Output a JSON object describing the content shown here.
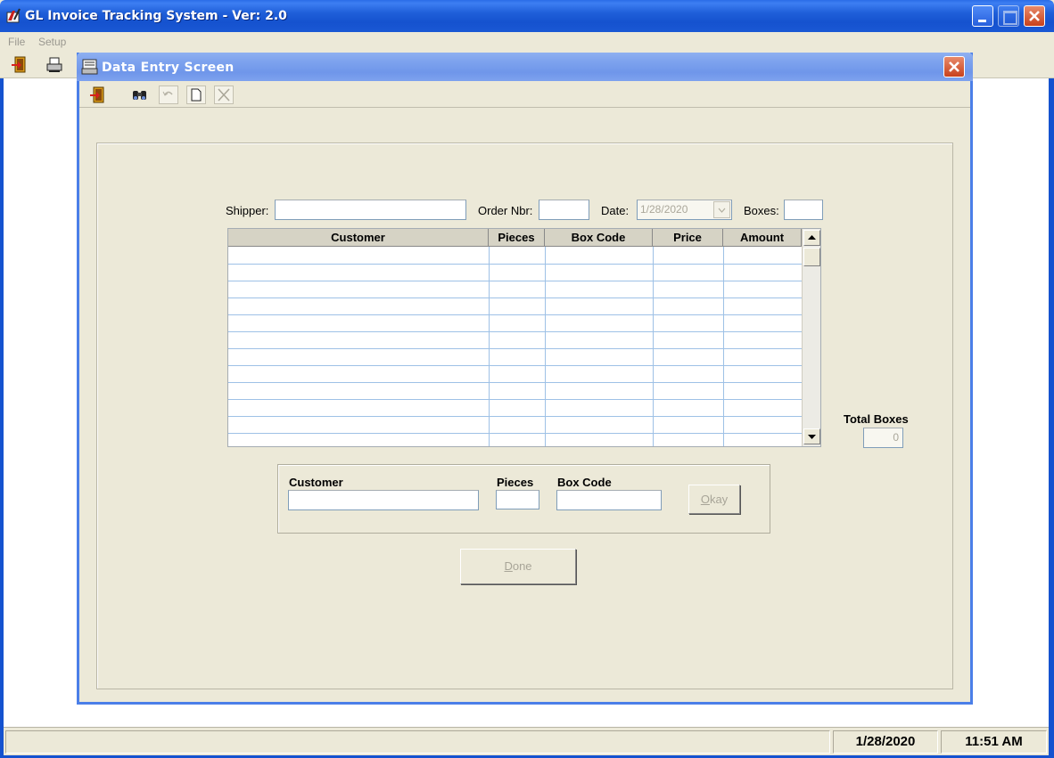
{
  "app": {
    "title": "GL Invoice Tracking System - Ver: 2.0",
    "menu": [
      "File",
      "Setup"
    ],
    "status": {
      "message": "",
      "date": "1/28/2020",
      "time": "11:51 AM"
    }
  },
  "child": {
    "title": "Data Entry Screen",
    "header": {
      "shipper_label": "Shipper:",
      "shipper_value": "",
      "order_label": "Order Nbr:",
      "order_value": "",
      "date_label": "Date:",
      "date_value": "1/28/2020",
      "boxes_label": "Boxes:",
      "boxes_value": ""
    },
    "grid": {
      "columns": [
        "Customer",
        "Pieces",
        "Box Code",
        "Price",
        "Amount"
      ],
      "rows": []
    },
    "total_boxes": {
      "label": "Total Boxes",
      "value": "0"
    },
    "entry": {
      "customer_label": "Customer",
      "pieces_label": "Pieces",
      "boxcode_label": "Box Code",
      "okay_accel": "O",
      "okay_rest": "kay"
    },
    "done_accel": "D",
    "done_rest": "one"
  }
}
